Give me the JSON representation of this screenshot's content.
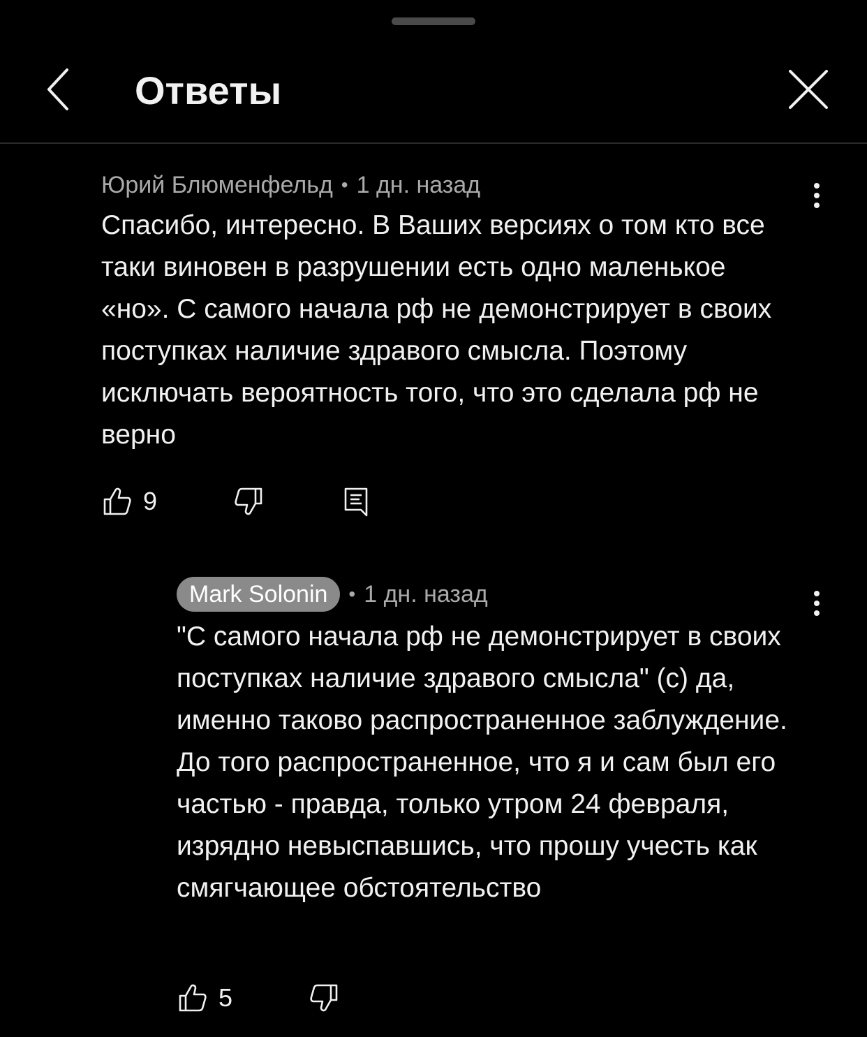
{
  "header": {
    "title": "Ответы"
  },
  "comments": [
    {
      "author": "Юрий Блюменфельд",
      "time": "1 дн. назад",
      "text": "Спасибо, интересно. В Ваших версиях о том кто все таки виновен в разрушении есть одно маленькое «но». С самого начала рф не демонстрирует в своих поступках наличие здравого смысла. Поэтому исключать вероятность того, что это сделала рф не верно",
      "likes": "9"
    },
    {
      "author": "Mark Solonin",
      "time": "1 дн. назад",
      "text": "\"С самого начала рф не демонстрирует в своих поступках наличие здравого смысла\" (с) да, именно таково распространенное заблуждение. До того распространенное, что я и сам был его частью - правда, только утром 24 февраля, изрядно невыспавшись, что прошу учесть как смягчающее обстоятельство",
      "likes": "5"
    }
  ],
  "colors": {
    "background": "#000000",
    "text": "#f1f1f1",
    "meta": "#aaaaaa",
    "badge": "#8a8a8a"
  },
  "icons": [
    "chevron-left-icon",
    "close-icon",
    "thumbs-up-icon",
    "thumbs-down-icon",
    "reply-icon",
    "more-vert-icon"
  ]
}
